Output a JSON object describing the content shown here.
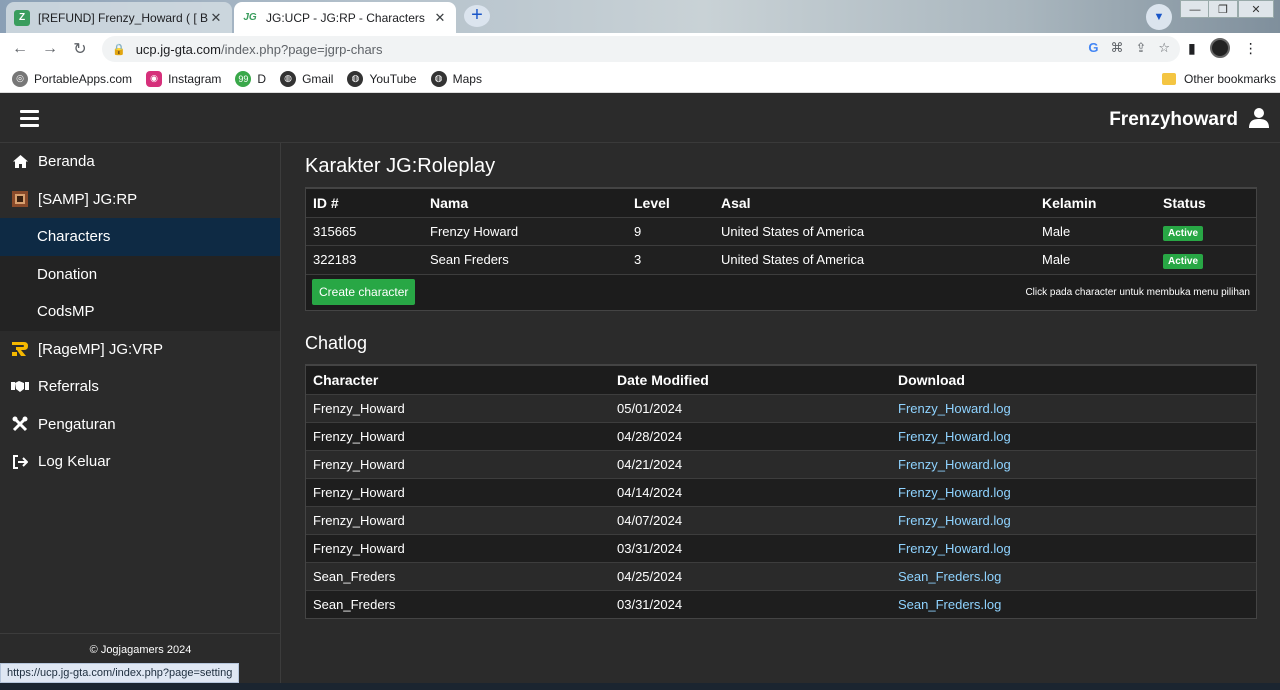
{
  "browser": {
    "tabs": [
      {
        "title": "[REFUND] Frenzy_Howard ( [ BEN",
        "favicon": "Z",
        "active": false
      },
      {
        "title": "JG:UCP - JG:RP - Characters",
        "favicon": "JG",
        "active": true
      }
    ],
    "url_domain": "ucp.jg-gta.com",
    "url_path": "/index.php?page=jgrp-chars",
    "bookmarks": [
      "PortableApps.com",
      "Instagram",
      "D",
      "Gmail",
      "YouTube",
      "Maps"
    ],
    "other_bookmarks": "Other bookmarks",
    "status_url": "https://ucp.jg-gta.com/index.php?page=setting"
  },
  "header": {
    "username": "Frenzyhoward"
  },
  "sidebar": {
    "items": [
      {
        "label": "Beranda",
        "icon": "home-icon"
      },
      {
        "label": "[SAMP] JG:RP",
        "icon": "samp-icon"
      },
      {
        "label": "Characters",
        "sub": true,
        "active": true
      },
      {
        "label": "Donation",
        "sub": true
      },
      {
        "label": "CodsMP",
        "sub": true
      },
      {
        "label": "[RageMP] JG:VRP",
        "icon": "ragemp-icon"
      },
      {
        "label": "Referrals",
        "icon": "handshake-icon"
      },
      {
        "label": "Pengaturan",
        "icon": "tools-icon"
      },
      {
        "label": "Log Keluar",
        "icon": "logout-icon"
      }
    ],
    "footer": "© Jogjagamers 2024"
  },
  "characters": {
    "title": "Karakter JG:Roleplay",
    "columns": [
      "ID #",
      "Nama",
      "Level",
      "Asal",
      "Kelamin",
      "Status"
    ],
    "rows": [
      [
        "315665",
        "Frenzy Howard",
        "9",
        "United States of America",
        "Male",
        "Active"
      ],
      [
        "322183",
        "Sean Freders",
        "3",
        "United States of America",
        "Male",
        "Active"
      ]
    ],
    "create_label": "Create character",
    "hint": "Click pada character untuk membuka menu pilihan"
  },
  "chatlog": {
    "title": "Chatlog",
    "columns": [
      "Character",
      "Date Modified",
      "Download"
    ],
    "rows": [
      [
        "Frenzy_Howard",
        "05/01/2024",
        "Frenzy_Howard.log"
      ],
      [
        "Frenzy_Howard",
        "04/28/2024",
        "Frenzy_Howard.log"
      ],
      [
        "Frenzy_Howard",
        "04/21/2024",
        "Frenzy_Howard.log"
      ],
      [
        "Frenzy_Howard",
        "04/14/2024",
        "Frenzy_Howard.log"
      ],
      [
        "Frenzy_Howard",
        "04/07/2024",
        "Frenzy_Howard.log"
      ],
      [
        "Frenzy_Howard",
        "03/31/2024",
        "Frenzy_Howard.log"
      ],
      [
        "Sean_Freders",
        "04/25/2024",
        "Sean_Freders.log"
      ],
      [
        "Sean_Freders",
        "03/31/2024",
        "Sean_Freders.log"
      ]
    ]
  },
  "colors": {
    "accent_green": "#28a745",
    "active_nav": "#0e2a44",
    "link": "#8fd3ff"
  }
}
